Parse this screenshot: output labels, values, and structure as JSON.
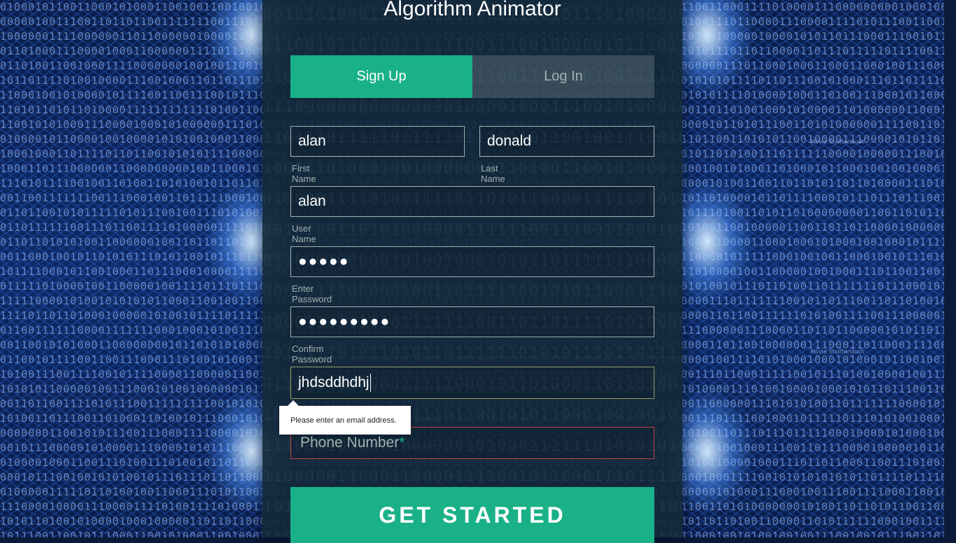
{
  "app": {
    "title": "Algorithm Animator"
  },
  "tabs": [
    {
      "label": "Sign Up",
      "active": true
    },
    {
      "label": "Log In",
      "active": false
    }
  ],
  "form": {
    "first_name": {
      "value": "alan",
      "label": "First Name"
    },
    "last_name": {
      "value": "donald",
      "label": "Last Name"
    },
    "user_name": {
      "value": "alan",
      "label": "User Name"
    },
    "password": {
      "value": "●●●●●",
      "label": "Enter Password"
    },
    "confirm_password": {
      "value": "●●●●●●●●●",
      "label": "Confirm Password"
    },
    "email": {
      "value": "jhdsddhdhj"
    },
    "phone": {
      "placeholder": "Phone Number",
      "required_mark": "*"
    }
  },
  "validation_tooltip": "Please enter an email address.",
  "submit_label": "GET STARTED",
  "watermarks": [
    "Movie Shutterstock",
    "Movie Shutterstock"
  ],
  "colors": {
    "accent": "#1ab188",
    "label": "#a0b3b0",
    "panel": "#14283a",
    "error": "#c84545"
  }
}
